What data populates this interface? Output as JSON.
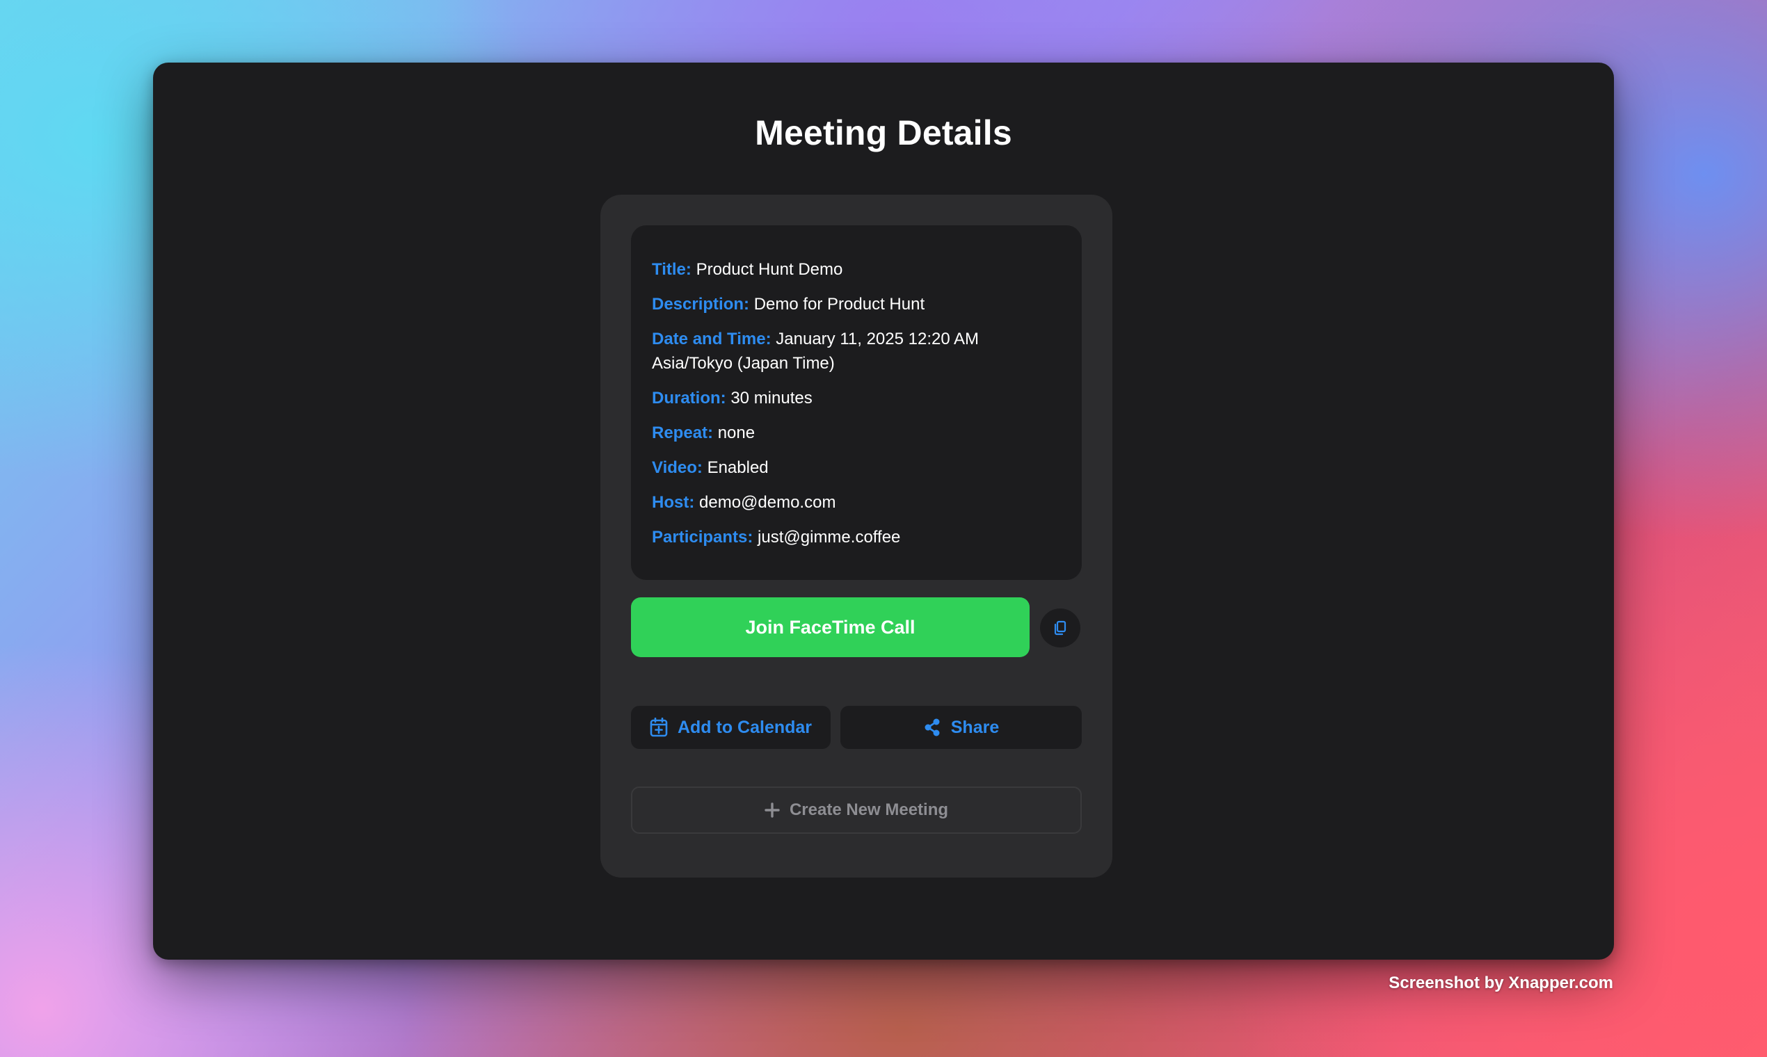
{
  "page": {
    "title": "Meeting Details"
  },
  "details": {
    "title": {
      "label": "Title:",
      "value": "Product Hunt Demo"
    },
    "description": {
      "label": "Description:",
      "value": "Demo for Product Hunt"
    },
    "datetime": {
      "label": "Date and Time:",
      "value": "January 11, 2025 12:20 AM Asia/Tokyo (Japan Time)"
    },
    "duration": {
      "label": "Duration:",
      "value": "30 minutes"
    },
    "repeat": {
      "label": "Repeat:",
      "value": "none"
    },
    "video": {
      "label": "Video:",
      "value": "Enabled"
    },
    "host": {
      "label": "Host:",
      "value": "demo@demo.com"
    },
    "participants": {
      "label": "Participants:",
      "value": "just@gimme.coffee"
    }
  },
  "actions": {
    "join_label": "Join FaceTime Call",
    "copy_icon": "copy-icon",
    "calendar_label": "Add to Calendar",
    "calendar_icon": "calendar-plus-icon",
    "share_label": "Share",
    "share_icon": "share-icon",
    "create_label": "Create New Meeting",
    "create_icon": "plus-icon"
  },
  "watermark": {
    "text": "Screenshot by Xnapper.com"
  },
  "colors": {
    "accent": "#2e8cf0",
    "join_green": "#30d158",
    "window_bg": "#1c1c1e",
    "card_bg": "#2c2c2e",
    "muted": "#8e8e93"
  }
}
